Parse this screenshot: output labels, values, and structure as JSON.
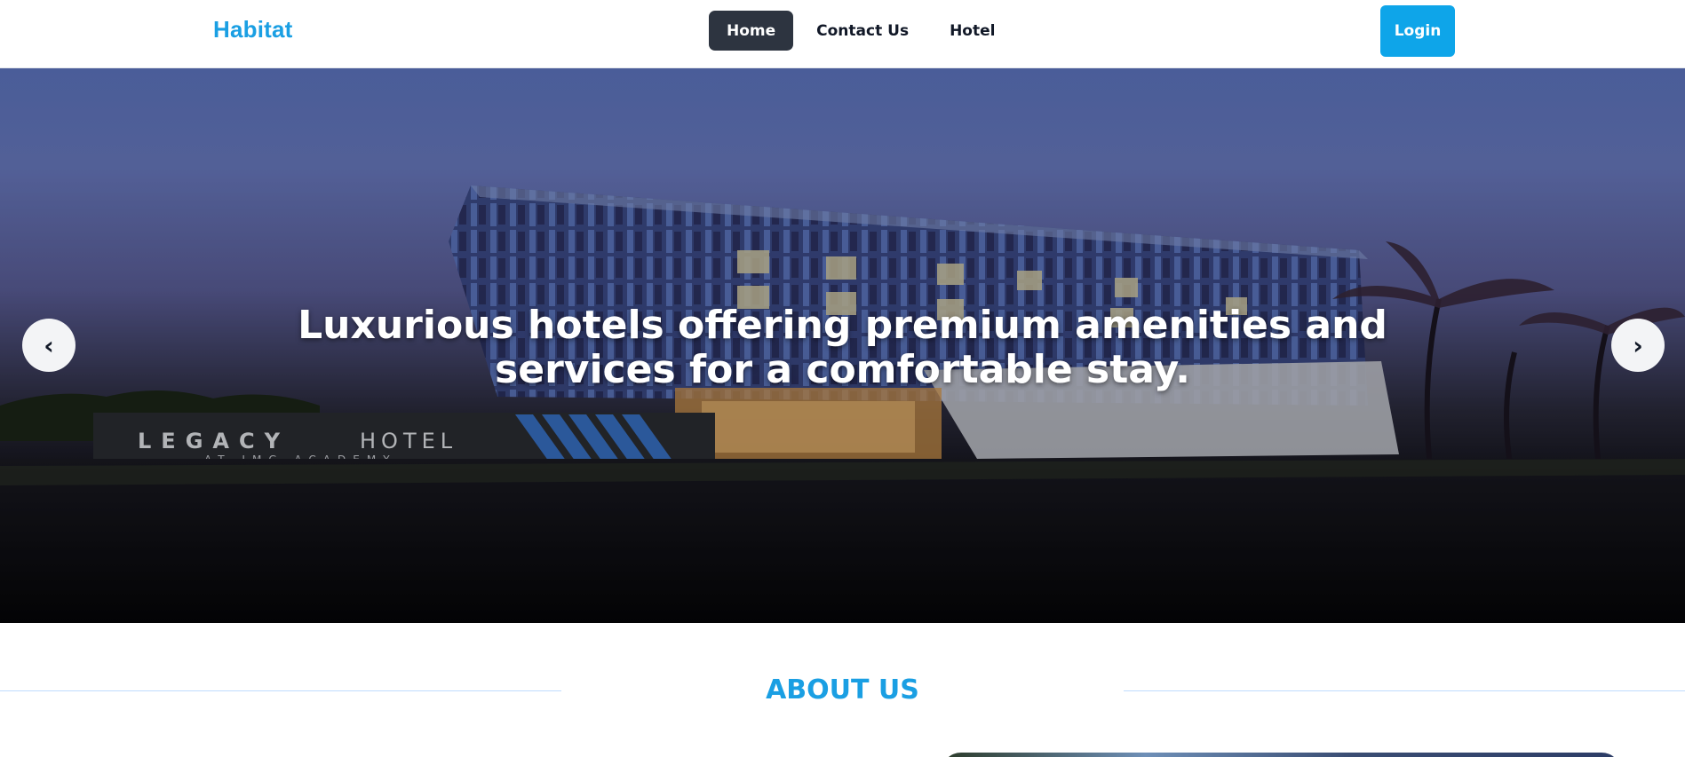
{
  "header": {
    "brand": "Habitat",
    "nav": [
      {
        "label": "Home",
        "active": true
      },
      {
        "label": "Contact Us",
        "active": false
      },
      {
        "label": "Hotel",
        "active": false
      }
    ],
    "login_label": "Login"
  },
  "hero": {
    "caption": "Luxurious hotels offering premium amenities and services for a comfortable stay.",
    "prev_icon": "‹",
    "next_icon": "›",
    "sign_text_1": "LEGACY",
    "sign_text_2": "HOTEL",
    "sign_subtext": "AT IMG ACADEMY"
  },
  "about": {
    "title": "ABOUT US"
  },
  "colors": {
    "brand": "#1a9fe3",
    "login_button": "#0ea5e9",
    "nav_active_bg": "#2d3440"
  }
}
